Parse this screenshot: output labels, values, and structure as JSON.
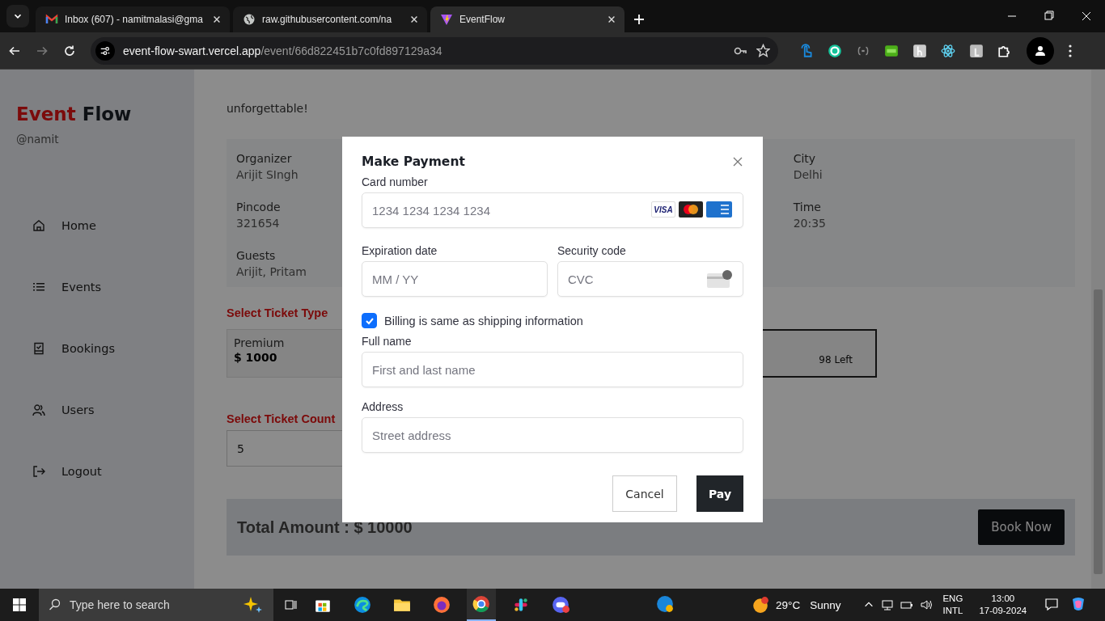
{
  "browser": {
    "tabs": [
      {
        "title": "Inbox (607) - namitmalasi@gma",
        "selected": false
      },
      {
        "title": "raw.githubusercontent.com/na",
        "selected": false
      },
      {
        "title": "EventFlow",
        "selected": true
      }
    ],
    "address": {
      "host": "event-flow-swart.vercel.app",
      "path": "/event/66d822451b7c0fd897129a34"
    }
  },
  "sidebar": {
    "brand": [
      "Event",
      "Flow"
    ],
    "handle": "@namit",
    "items": [
      {
        "label": "Home"
      },
      {
        "label": "Events"
      },
      {
        "label": "Bookings"
      },
      {
        "label": "Users"
      },
      {
        "label": "Logout"
      }
    ]
  },
  "event": {
    "description_tail": "unforgettable!",
    "details_column_1": [
      {
        "label": "Organizer",
        "value": "Arijit SIngh"
      },
      {
        "label": "Pincode",
        "value": "321654"
      },
      {
        "label": "Guests",
        "value": "Arijit, Pritam"
      }
    ],
    "details_column_3": [
      {
        "label": "City",
        "value": "Delhi"
      },
      {
        "label": "Time",
        "value": "20:35"
      }
    ]
  },
  "ticket_type": {
    "heading": "Select Ticket Type",
    "options": [
      {
        "name": "Premium",
        "price": "$ 1000",
        "selected": false
      },
      {
        "remaining": "98 Left",
        "selected": true
      }
    ]
  },
  "ticket_count": {
    "heading": "Select Ticket Count",
    "value": "5"
  },
  "total": {
    "label": "Total Amount : $ 10000",
    "button": "Book Now"
  },
  "payment_dialog": {
    "title": "Make Payment",
    "card_number": {
      "label": "Card number",
      "placeholder": "1234 1234 1234 1234",
      "brand_text": "VISA"
    },
    "expiration": {
      "label": "Expiration date",
      "placeholder": "MM / YY"
    },
    "security_code": {
      "label": "Security code",
      "placeholder": "CVC"
    },
    "billing_same": {
      "label": "Billing is same as shipping information",
      "checked": true
    },
    "full_name": {
      "label": "Full name",
      "placeholder": "First and last name"
    },
    "address": {
      "label": "Address",
      "placeholder": "Street address"
    },
    "buttons": {
      "cancel": "Cancel",
      "pay": "Pay"
    }
  },
  "taskbar": {
    "search_placeholder": "Type here to search",
    "temperature": "29°C",
    "weather": "Sunny",
    "language": [
      "ENG",
      "INTL"
    ],
    "time": "13:00",
    "date": "17-09-2024"
  }
}
